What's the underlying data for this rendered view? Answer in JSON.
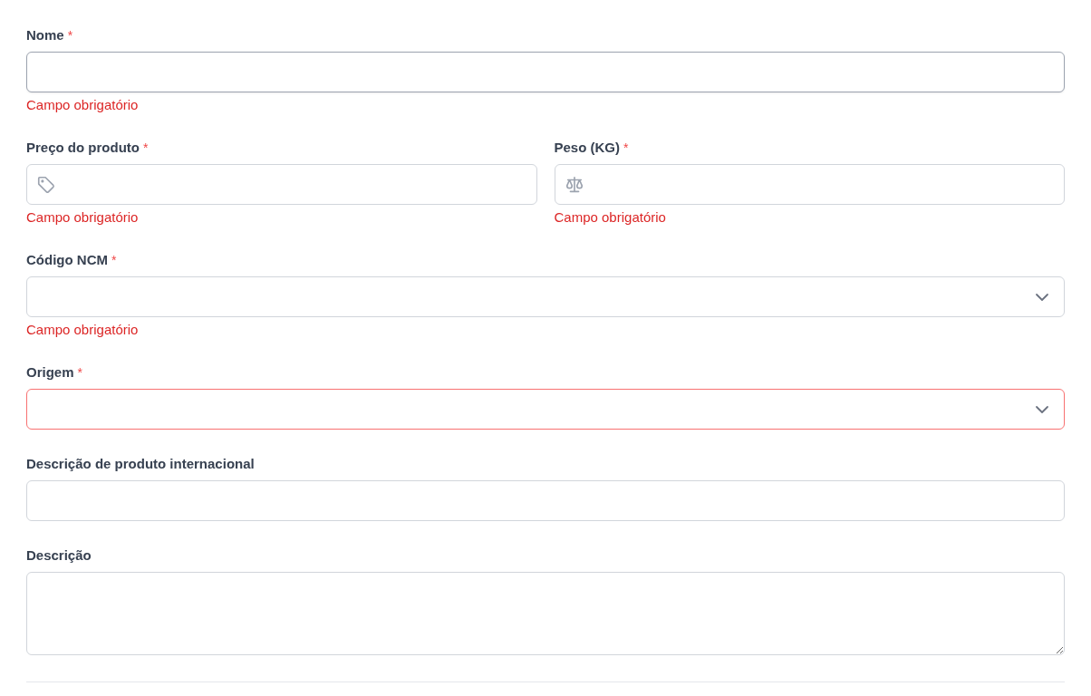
{
  "rows": [
    {
      "fields": [
        {
          "label": "Nome",
          "required": true,
          "kind": "input",
          "focused": true,
          "invalid": false,
          "error": "Campo obrigatório"
        }
      ]
    },
    {
      "fields": [
        {
          "label": "Preço do produto",
          "required": true,
          "kind": "tag-input",
          "focused": false,
          "invalid": false,
          "error": "Campo obrigatório"
        },
        {
          "label": "Peso (KG)",
          "required": true,
          "kind": "scale-input",
          "focused": false,
          "invalid": false,
          "error": "Campo obrigatório"
        }
      ]
    },
    {
      "fields": [
        {
          "label": "Código NCM",
          "required": true,
          "kind": "select",
          "focused": false,
          "invalid": false,
          "error": "Campo obrigatório"
        }
      ]
    },
    {
      "fields": [
        {
          "label": "Origem",
          "required": true,
          "kind": "select",
          "focused": false,
          "invalid": true
        }
      ]
    },
    {
      "fields": [
        {
          "label": "Descrição de produto internacional",
          "required": false,
          "kind": "input",
          "focused": false,
          "invalid": false
        }
      ]
    },
    {
      "fields": [
        {
          "label": "Descrição",
          "required": false,
          "kind": "textarea",
          "focused": false,
          "invalid": false
        }
      ]
    }
  ],
  "required_mark": "*"
}
